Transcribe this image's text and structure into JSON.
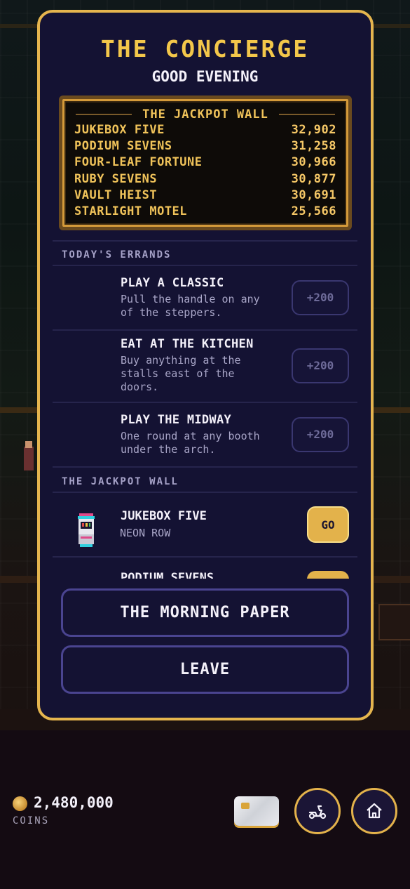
{
  "modal": {
    "title": "THE CONCIERGE",
    "greeting": "GOOD EVENING"
  },
  "jackpot_board": {
    "heading": "THE JACKPOT WALL",
    "rows": [
      {
        "name": "JUKEBOX FIVE",
        "value": "32,902"
      },
      {
        "name": "PODIUM SEVENS",
        "value": "31,258"
      },
      {
        "name": "FOUR-LEAF FORTUNE",
        "value": "30,966"
      },
      {
        "name": "RUBY SEVENS",
        "value": "30,877"
      },
      {
        "name": "VAULT HEIST",
        "value": "30,691"
      },
      {
        "name": "STARLIGHT MOTEL",
        "value": "25,566"
      }
    ]
  },
  "errands": {
    "label": "TODAY'S ERRANDS",
    "items": [
      {
        "name": "PLAY A CLASSIC",
        "desc_lines": [
          "Pull the handle on any",
          "of the steppers."
        ],
        "reward": "+200"
      },
      {
        "name": "EAT AT THE KITCHEN",
        "desc_lines": [
          "Buy anything at the",
          "stalls east of the",
          "doors."
        ],
        "reward": "+200"
      },
      {
        "name": "PLAY THE MIDWAY",
        "desc_lines": [
          "One round at any booth",
          "under the arch."
        ],
        "reward": "+200"
      }
    ]
  },
  "jackpot_wall": {
    "label": "THE JACKPOT WALL",
    "items": [
      {
        "name": "JUKEBOX FIVE",
        "location": "NEON ROW",
        "action": "GO"
      },
      {
        "name": "PODIUM SEVENS",
        "action": "GO"
      }
    ]
  },
  "buttons": {
    "paper": "THE MORNING PAPER",
    "leave": "LEAVE"
  },
  "hud": {
    "coins_value": "2,480,000",
    "coins_label": "COINS",
    "icons": [
      "coin-icon",
      "card-icon",
      "scooter-icon",
      "home-icon"
    ]
  },
  "colors": {
    "accent_gold": "#e3b24b",
    "modal_bg": "#141233",
    "title_gold": "#f3c74a"
  }
}
